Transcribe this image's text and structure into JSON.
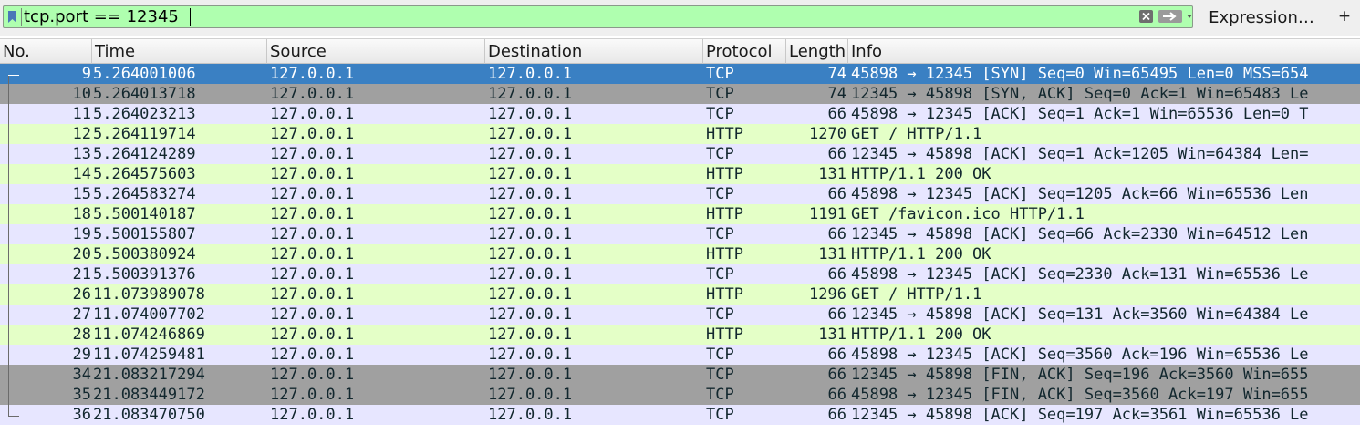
{
  "filter": {
    "value": "tcp.port == 12345",
    "background": "#afffaf",
    "bookmark_icon": "bookmark-icon",
    "clear_icon": "clear-icon",
    "apply_icon": "arrow-right-icon",
    "dropdown_icon": "chevron-down-icon",
    "expression_label": "Expression…",
    "add_label": "+"
  },
  "columns": [
    "No.",
    "Time",
    "Source",
    "Destination",
    "Protocol",
    "Length",
    "Info"
  ],
  "colors": {
    "selected_bg": "#3a80c3",
    "tcp_bg": "#e7e6ff",
    "http_bg": "#e4ffc7",
    "gray_bg": "#a0a0a0"
  },
  "packets": [
    {
      "no": "9",
      "time": "5.264001006",
      "src": "127.0.0.1",
      "dst": "127.0.0.1",
      "proto": "TCP",
      "len": "74",
      "info": "45898 → 12345 [SYN] Seq=0 Win=65495 Len=0 MSS=654",
      "style": "selected"
    },
    {
      "no": "10",
      "time": "5.264013718",
      "src": "127.0.0.1",
      "dst": "127.0.0.1",
      "proto": "TCP",
      "len": "74",
      "info": "12345 → 45898 [SYN, ACK] Seq=0 Ack=1 Win=65483 Le",
      "style": "gray"
    },
    {
      "no": "11",
      "time": "5.264023213",
      "src": "127.0.0.1",
      "dst": "127.0.0.1",
      "proto": "TCP",
      "len": "66",
      "info": "45898 → 12345 [ACK] Seq=1 Ack=1 Win=65536 Len=0 T",
      "style": "tcp"
    },
    {
      "no": "12",
      "time": "5.264119714",
      "src": "127.0.0.1",
      "dst": "127.0.0.1",
      "proto": "HTTP",
      "len": "1270",
      "info": "GET / HTTP/1.1",
      "style": "http"
    },
    {
      "no": "13",
      "time": "5.264124289",
      "src": "127.0.0.1",
      "dst": "127.0.0.1",
      "proto": "TCP",
      "len": "66",
      "info": "12345 → 45898 [ACK] Seq=1 Ack=1205 Win=64384 Len=",
      "style": "tcp"
    },
    {
      "no": "14",
      "time": "5.264575603",
      "src": "127.0.0.1",
      "dst": "127.0.0.1",
      "proto": "HTTP",
      "len": "131",
      "info": "HTTP/1.1 200 OK",
      "style": "http"
    },
    {
      "no": "15",
      "time": "5.264583274",
      "src": "127.0.0.1",
      "dst": "127.0.0.1",
      "proto": "TCP",
      "len": "66",
      "info": "45898 → 12345 [ACK] Seq=1205 Ack=66 Win=65536 Len",
      "style": "tcp"
    },
    {
      "no": "18",
      "time": "5.500140187",
      "src": "127.0.0.1",
      "dst": "127.0.0.1",
      "proto": "HTTP",
      "len": "1191",
      "info": "GET /favicon.ico HTTP/1.1",
      "style": "http"
    },
    {
      "no": "19",
      "time": "5.500155807",
      "src": "127.0.0.1",
      "dst": "127.0.0.1",
      "proto": "TCP",
      "len": "66",
      "info": "12345 → 45898 [ACK] Seq=66 Ack=2330 Win=64512 Len",
      "style": "tcp"
    },
    {
      "no": "20",
      "time": "5.500380924",
      "src": "127.0.0.1",
      "dst": "127.0.0.1",
      "proto": "HTTP",
      "len": "131",
      "info": "HTTP/1.1 200 OK",
      "style": "http"
    },
    {
      "no": "21",
      "time": "5.500391376",
      "src": "127.0.0.1",
      "dst": "127.0.0.1",
      "proto": "TCP",
      "len": "66",
      "info": "45898 → 12345 [ACK] Seq=2330 Ack=131 Win=65536 Le",
      "style": "tcp"
    },
    {
      "no": "26",
      "time": "11.073989078",
      "src": "127.0.0.1",
      "dst": "127.0.0.1",
      "proto": "HTTP",
      "len": "1296",
      "info": "GET / HTTP/1.1",
      "style": "http"
    },
    {
      "no": "27",
      "time": "11.074007702",
      "src": "127.0.0.1",
      "dst": "127.0.0.1",
      "proto": "TCP",
      "len": "66",
      "info": "12345 → 45898 [ACK] Seq=131 Ack=3560 Win=64384 Le",
      "style": "tcp"
    },
    {
      "no": "28",
      "time": "11.074246869",
      "src": "127.0.0.1",
      "dst": "127.0.0.1",
      "proto": "HTTP",
      "len": "131",
      "info": "HTTP/1.1 200 OK",
      "style": "http"
    },
    {
      "no": "29",
      "time": "11.074259481",
      "src": "127.0.0.1",
      "dst": "127.0.0.1",
      "proto": "TCP",
      "len": "66",
      "info": "45898 → 12345 [ACK] Seq=3560 Ack=196 Win=65536 Le",
      "style": "tcp"
    },
    {
      "no": "34",
      "time": "21.083217294",
      "src": "127.0.0.1",
      "dst": "127.0.0.1",
      "proto": "TCP",
      "len": "66",
      "info": "12345 → 45898 [FIN, ACK] Seq=196 Ack=3560 Win=655",
      "style": "gray"
    },
    {
      "no": "35",
      "time": "21.083449172",
      "src": "127.0.0.1",
      "dst": "127.0.0.1",
      "proto": "TCP",
      "len": "66",
      "info": "45898 → 12345 [FIN, ACK] Seq=3560 Ack=197 Win=655",
      "style": "gray"
    },
    {
      "no": "36",
      "time": "21.083470750",
      "src": "127.0.0.1",
      "dst": "127.0.0.1",
      "proto": "TCP",
      "len": "66",
      "info": "12345 → 45898 [ACK] Seq=197 Ack=3561 Win=65536 Le",
      "style": "tcp"
    }
  ]
}
